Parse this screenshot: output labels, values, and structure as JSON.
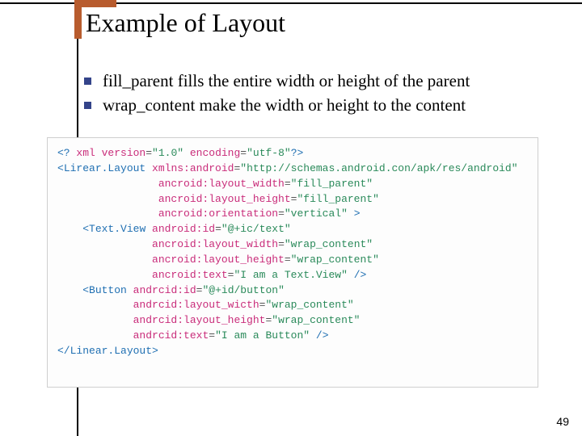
{
  "title": "Example of Layout",
  "bullets": [
    "fill_parent fills the entire width or height of the parent",
    "wrap_content make the width or height to the content"
  ],
  "code": {
    "l1_open": "<?",
    "l1_tag": " xml version",
    "l1_a1": "=",
    "l1_v1": "\"1.0\"",
    "l1_tag2": " encoding",
    "l1_a2": "=",
    "l1_v2": "\"utf-8\"",
    "l1_close": "?>",
    "l2_open": "<",
    "l2_tag": "Lirear.Layout",
    "l2_a1": " xmlns:android",
    "l2_eq": "=",
    "l2_v1": "\"http://schemas.android.con/apk/res/android\"",
    "l3_a": "ancroid:layout_width",
    "l3_eq": "=",
    "l3_v": "\"fill_parent\"",
    "l4_a": "ancroid:layout_height",
    "l4_eq": "=",
    "l4_v": "\"fill_parent\"",
    "l5_a": "ancroid:orientation",
    "l5_eq": "=",
    "l5_v": "\"vertical\"",
    "l5_close": " >",
    "l6_open": "<",
    "l6_tag": "Text.View",
    "l6_a1": " android:id",
    "l6_eq": "=",
    "l6_v1": "\"@+ic/text\"",
    "l7_a": "ancroid:layout_width",
    "l7_eq": "=",
    "l7_v": "\"wrap_content\"",
    "l8_a": "ancroid:layout_height",
    "l8_eq": "=",
    "l8_v": "\"wrap_content\"",
    "l9_a": "ancroid:text",
    "l9_eq": "=",
    "l9_v": "\"I am a Text.View\"",
    "l9_close": " />",
    "l10_open": "<",
    "l10_tag": "Button",
    "l10_a1": " andrcid:id",
    "l10_eq": "=",
    "l10_v1": "\"@+id/button\"",
    "l11_a": "andrcid:layout_wicth",
    "l11_eq": "=",
    "l11_v": "\"wrap_content\"",
    "l12_a": "andrcid:layout_height",
    "l12_eq": "=",
    "l12_v": "\"wrap_content\"",
    "l13_a": "andrcid:text",
    "l13_eq": "=",
    "l13_v": "\"I am a Button\"",
    "l13_close": " />",
    "l14_open": "</",
    "l14_tag": "Linear.Layout",
    "l14_close": ">"
  },
  "indent1": "                ",
  "indent2": "    ",
  "indent3": "               ",
  "indent4": "            ",
  "page_number": "49"
}
